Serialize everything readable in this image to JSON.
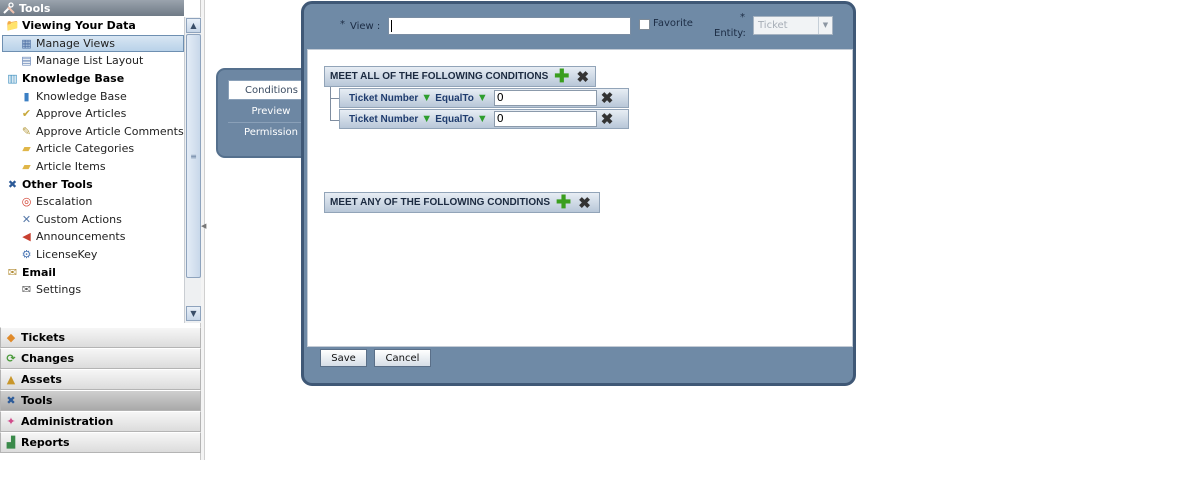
{
  "nav": {
    "header": "Tools",
    "tree": [
      {
        "type": "cat",
        "label": "Viewing Your Data",
        "icon": "folder-plus-icon"
      },
      {
        "type": "item",
        "label": "Manage Views",
        "icon": "views-icon",
        "selected": true
      },
      {
        "type": "item",
        "label": "Manage List Layout",
        "icon": "layout-icon"
      },
      {
        "type": "cat",
        "label": "Knowledge Base",
        "icon": "books-icon"
      },
      {
        "type": "item",
        "label": "Knowledge Base",
        "icon": "book-icon"
      },
      {
        "type": "item",
        "label": "Approve Articles",
        "icon": "approve-icon"
      },
      {
        "type": "item",
        "label": "Approve Article Comments",
        "icon": "comments-icon"
      },
      {
        "type": "item",
        "label": "Article Categories",
        "icon": "folder-icon"
      },
      {
        "type": "item",
        "label": "Article Items",
        "icon": "folder-icon"
      },
      {
        "type": "cat",
        "label": "Other Tools",
        "icon": "tools-icon"
      },
      {
        "type": "item",
        "label": "Escalation",
        "icon": "lifebuoy-icon"
      },
      {
        "type": "item",
        "label": "Custom Actions",
        "icon": "tools-small-icon"
      },
      {
        "type": "item",
        "label": "Announcements",
        "icon": "megaphone-icon"
      },
      {
        "type": "item",
        "label": "LicenseKey",
        "icon": "key-icon"
      },
      {
        "type": "cat",
        "label": "Email",
        "icon": "email-icon"
      },
      {
        "type": "item",
        "label": "Settings",
        "icon": "email-settings-icon"
      }
    ],
    "modules": [
      {
        "label": "Tickets",
        "icon": "ticket-icon"
      },
      {
        "label": "Changes",
        "icon": "changes-icon"
      },
      {
        "label": "Assets",
        "icon": "assets-icon"
      },
      {
        "label": "Tools",
        "icon": "tools-icon",
        "active": true
      },
      {
        "label": "Administration",
        "icon": "puzzle-icon"
      },
      {
        "label": "Reports",
        "icon": "reports-icon"
      }
    ]
  },
  "side_tabs": [
    "Conditions",
    "Preview",
    "Permission"
  ],
  "form": {
    "required_mark": "*",
    "view_label": "View :",
    "view_value": "",
    "favorite_label": "Favorite",
    "entity_label": "Entity:",
    "entity_value": "Ticket"
  },
  "conditions": {
    "all_group": {
      "title": "MEET ALL OF THE FOLLOWING CONDITIONS",
      "rows": [
        {
          "field": "Ticket Number",
          "operator": "EqualTo",
          "value": "0"
        },
        {
          "field": "Ticket Number",
          "operator": "EqualTo",
          "value": "0"
        }
      ]
    },
    "any_group": {
      "title": "MEET ANY OF THE FOLLOWING CONDITIONS",
      "rows": []
    }
  },
  "buttons": {
    "save": "Save",
    "cancel": "Cancel"
  }
}
